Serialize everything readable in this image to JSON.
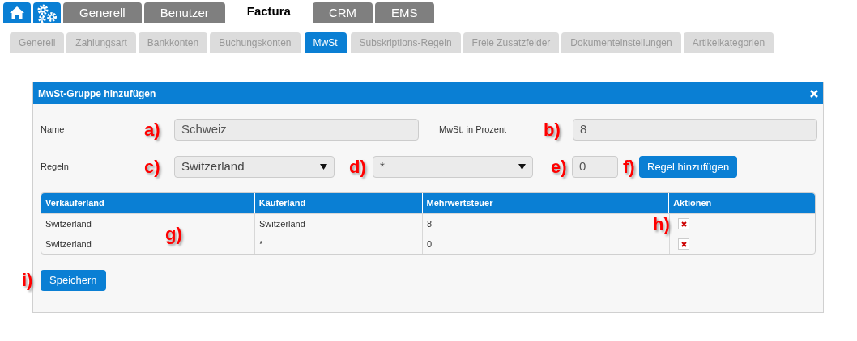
{
  "main_tabs": [
    {
      "label": "Generell",
      "selected": false
    },
    {
      "label": "Benutzer",
      "selected": false
    },
    {
      "label": "Factura",
      "selected": true
    },
    {
      "label": "CRM",
      "selected": false
    },
    {
      "label": "EMS",
      "selected": false
    }
  ],
  "sub_tabs": [
    {
      "label": "Generell",
      "selected": false
    },
    {
      "label": "Zahlungsart",
      "selected": false
    },
    {
      "label": "Bankkonten",
      "selected": false
    },
    {
      "label": "Buchungskonten",
      "selected": false
    },
    {
      "label": "MwSt",
      "selected": true
    },
    {
      "label": "Subskriptions-Regeln",
      "selected": false
    },
    {
      "label": "Freie Zusatzfelder",
      "selected": false
    },
    {
      "label": "Dokumenteinstellungen",
      "selected": false
    },
    {
      "label": "Artikelkategorien",
      "selected": false
    }
  ],
  "dialog": {
    "title": "MwSt-Gruppe hinzufügen",
    "name": {
      "label": "Name",
      "marker": "a)",
      "value": "Schweiz"
    },
    "percent": {
      "label": "MwSt. in Prozent",
      "marker": "b)",
      "value": "8"
    },
    "rules": {
      "label": "Regeln",
      "seller": {
        "marker": "c)",
        "value": "Switzerland"
      },
      "buyer": {
        "marker": "d)",
        "value": "*"
      },
      "rate": {
        "marker": "e)",
        "value": "0"
      },
      "add_button": {
        "marker": "f)",
        "label": "Regel hinzufügen"
      }
    },
    "table": {
      "marker": "g)",
      "columns": [
        "Verkäuferland",
        "Käuferland",
        "Mehrwertsteuer",
        "Aktionen"
      ],
      "rows": [
        {
          "cells": [
            "Switzerland",
            "Switzerland",
            "8"
          ],
          "marker": "h)"
        },
        {
          "cells": [
            "Switzerland",
            "*",
            "0"
          ]
        }
      ]
    },
    "save_button": {
      "marker": "i)",
      "label": "Speichern"
    }
  }
}
